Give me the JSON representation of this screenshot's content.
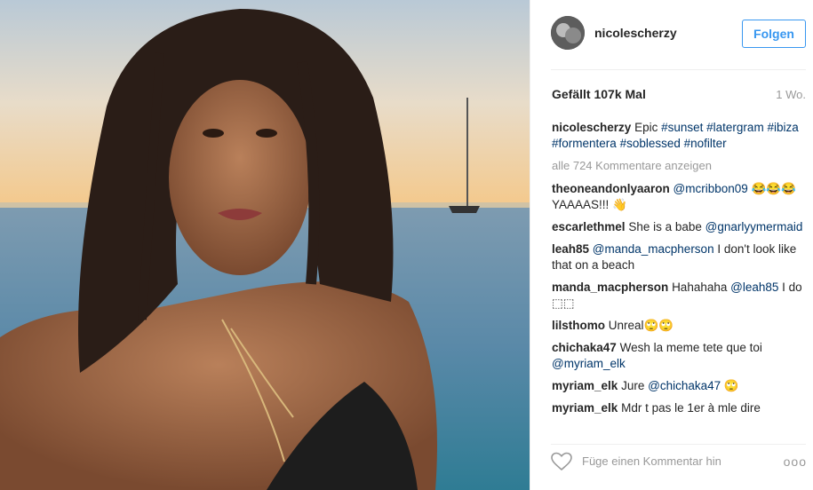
{
  "post": {
    "username": "nicolescherzy",
    "follow_label": "Folgen",
    "likes": "Gefällt 107k Mal",
    "time": "1 Wo.",
    "caption": {
      "user": "nicolescherzy",
      "text": "Epic",
      "tags": [
        "#sunset",
        "#latergram",
        "#ibiza",
        "#formentera",
        "#soblessed",
        "#nofilter"
      ]
    },
    "view_all": "alle 724 Kommentare anzeigen",
    "comments": [
      {
        "user": "theoneandonlyaaron",
        "mention": "@mcribbon09",
        "text": "😂😂😂 YAAAAS!!! 👋"
      },
      {
        "user": "escarlethmel",
        "text": "She is a babe",
        "mention": "@gnarlyymermaid"
      },
      {
        "user": "leah85",
        "mention": "@manda_macpherson",
        "text": "I don't look like that on a beach"
      },
      {
        "user": "manda_macpherson",
        "text": "Hahahaha",
        "mention": "@leah85",
        "text2": "I do ⬚⬚"
      },
      {
        "user": "lilsthomo",
        "text": "Unreal🙄🙄"
      },
      {
        "user": "chichaka47",
        "text": "Wesh la meme tete que toi",
        "mention": "@myriam_elk"
      },
      {
        "user": "myriam_elk",
        "text": "Jure",
        "mention": "@chichaka47",
        "text2": "🙄"
      },
      {
        "user": "myriam_elk",
        "text": "Mdr t pas le 1er à mle dire"
      }
    ],
    "add_comment_placeholder": "Füge einen Kommentar hin",
    "more_label": "ooo"
  },
  "icons": {
    "like": "heart-outline-icon",
    "more": "more-options-icon"
  },
  "colors": {
    "link": "#003569",
    "follow": "#3897f0",
    "muted": "#999999"
  }
}
